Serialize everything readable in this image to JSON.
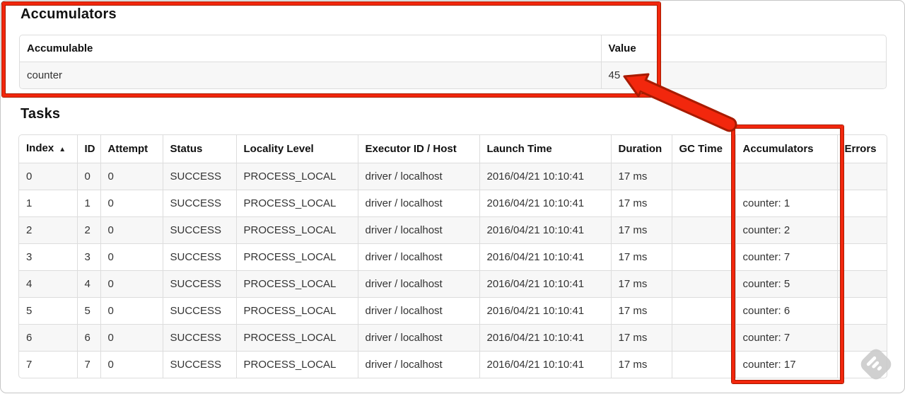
{
  "accumulators": {
    "heading": "Accumulators",
    "col_accumulable": "Accumulable",
    "col_value": "Value",
    "rows": [
      {
        "name": "counter",
        "value": "45"
      }
    ]
  },
  "tasks": {
    "heading": "Tasks",
    "headers": {
      "index": "Index",
      "sort_arrow": "▲",
      "id": "ID",
      "attempt": "Attempt",
      "status": "Status",
      "locality": "Locality Level",
      "executor": "Executor ID / Host",
      "launch": "Launch Time",
      "duration": "Duration",
      "gc": "GC Time",
      "accumulators": "Accumulators",
      "errors": "Errors"
    },
    "rows": [
      {
        "index": "0",
        "id": "0",
        "attempt": "0",
        "status": "SUCCESS",
        "locality": "PROCESS_LOCAL",
        "executor": "driver / localhost",
        "launch": "2016/04/21 10:10:41",
        "duration": "17 ms",
        "gc": "",
        "accumulators": "",
        "errors": ""
      },
      {
        "index": "1",
        "id": "1",
        "attempt": "0",
        "status": "SUCCESS",
        "locality": "PROCESS_LOCAL",
        "executor": "driver / localhost",
        "launch": "2016/04/21 10:10:41",
        "duration": "17 ms",
        "gc": "",
        "accumulators": "counter: 1",
        "errors": ""
      },
      {
        "index": "2",
        "id": "2",
        "attempt": "0",
        "status": "SUCCESS",
        "locality": "PROCESS_LOCAL",
        "executor": "driver / localhost",
        "launch": "2016/04/21 10:10:41",
        "duration": "17 ms",
        "gc": "",
        "accumulators": "counter: 2",
        "errors": ""
      },
      {
        "index": "3",
        "id": "3",
        "attempt": "0",
        "status": "SUCCESS",
        "locality": "PROCESS_LOCAL",
        "executor": "driver / localhost",
        "launch": "2016/04/21 10:10:41",
        "duration": "17 ms",
        "gc": "",
        "accumulators": "counter: 7",
        "errors": ""
      },
      {
        "index": "4",
        "id": "4",
        "attempt": "0",
        "status": "SUCCESS",
        "locality": "PROCESS_LOCAL",
        "executor": "driver / localhost",
        "launch": "2016/04/21 10:10:41",
        "duration": "17 ms",
        "gc": "",
        "accumulators": "counter: 5",
        "errors": ""
      },
      {
        "index": "5",
        "id": "5",
        "attempt": "0",
        "status": "SUCCESS",
        "locality": "PROCESS_LOCAL",
        "executor": "driver / localhost",
        "launch": "2016/04/21 10:10:41",
        "duration": "17 ms",
        "gc": "",
        "accumulators": "counter: 6",
        "errors": ""
      },
      {
        "index": "6",
        "id": "6",
        "attempt": "0",
        "status": "SUCCESS",
        "locality": "PROCESS_LOCAL",
        "executor": "driver / localhost",
        "launch": "2016/04/21 10:10:41",
        "duration": "17 ms",
        "gc": "",
        "accumulators": "counter: 7",
        "errors": ""
      },
      {
        "index": "7",
        "id": "7",
        "attempt": "0",
        "status": "SUCCESS",
        "locality": "PROCESS_LOCAL",
        "executor": "driver / localhost",
        "launch": "2016/04/21 10:10:41",
        "duration": "17 ms",
        "gc": "",
        "accumulators": "counter: 17",
        "errors": ""
      }
    ]
  },
  "annotations": {
    "highlight_color": "#f2270d",
    "highlight_outline_color": "#a81b00",
    "watermark_icon": "feedly-logo",
    "watermark_color": "#cbcbcb"
  }
}
